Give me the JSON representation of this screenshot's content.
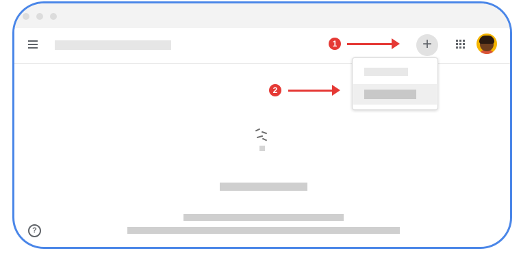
{
  "window": {
    "controls": [
      "close",
      "minimize",
      "maximize"
    ]
  },
  "appbar": {
    "menu_icon": "hamburger-icon",
    "create_button": {
      "label": "+",
      "icon": "plus-icon"
    },
    "apps_icon": "apps-grid-icon",
    "avatar_icon": "user-avatar"
  },
  "annotations": {
    "step1": "1",
    "step2": "2",
    "color": "#e53935"
  },
  "dropdown": {
    "items": [
      "menu-item-1",
      "menu-item-2"
    ]
  },
  "empty_state": {
    "illustration": "empty-state-illustration"
  },
  "footer": {
    "help_icon": "?"
  },
  "colors": {
    "frame_border": "#4a86e8",
    "annotation_red": "#e53935",
    "avatar_bg": "#f4b400"
  }
}
